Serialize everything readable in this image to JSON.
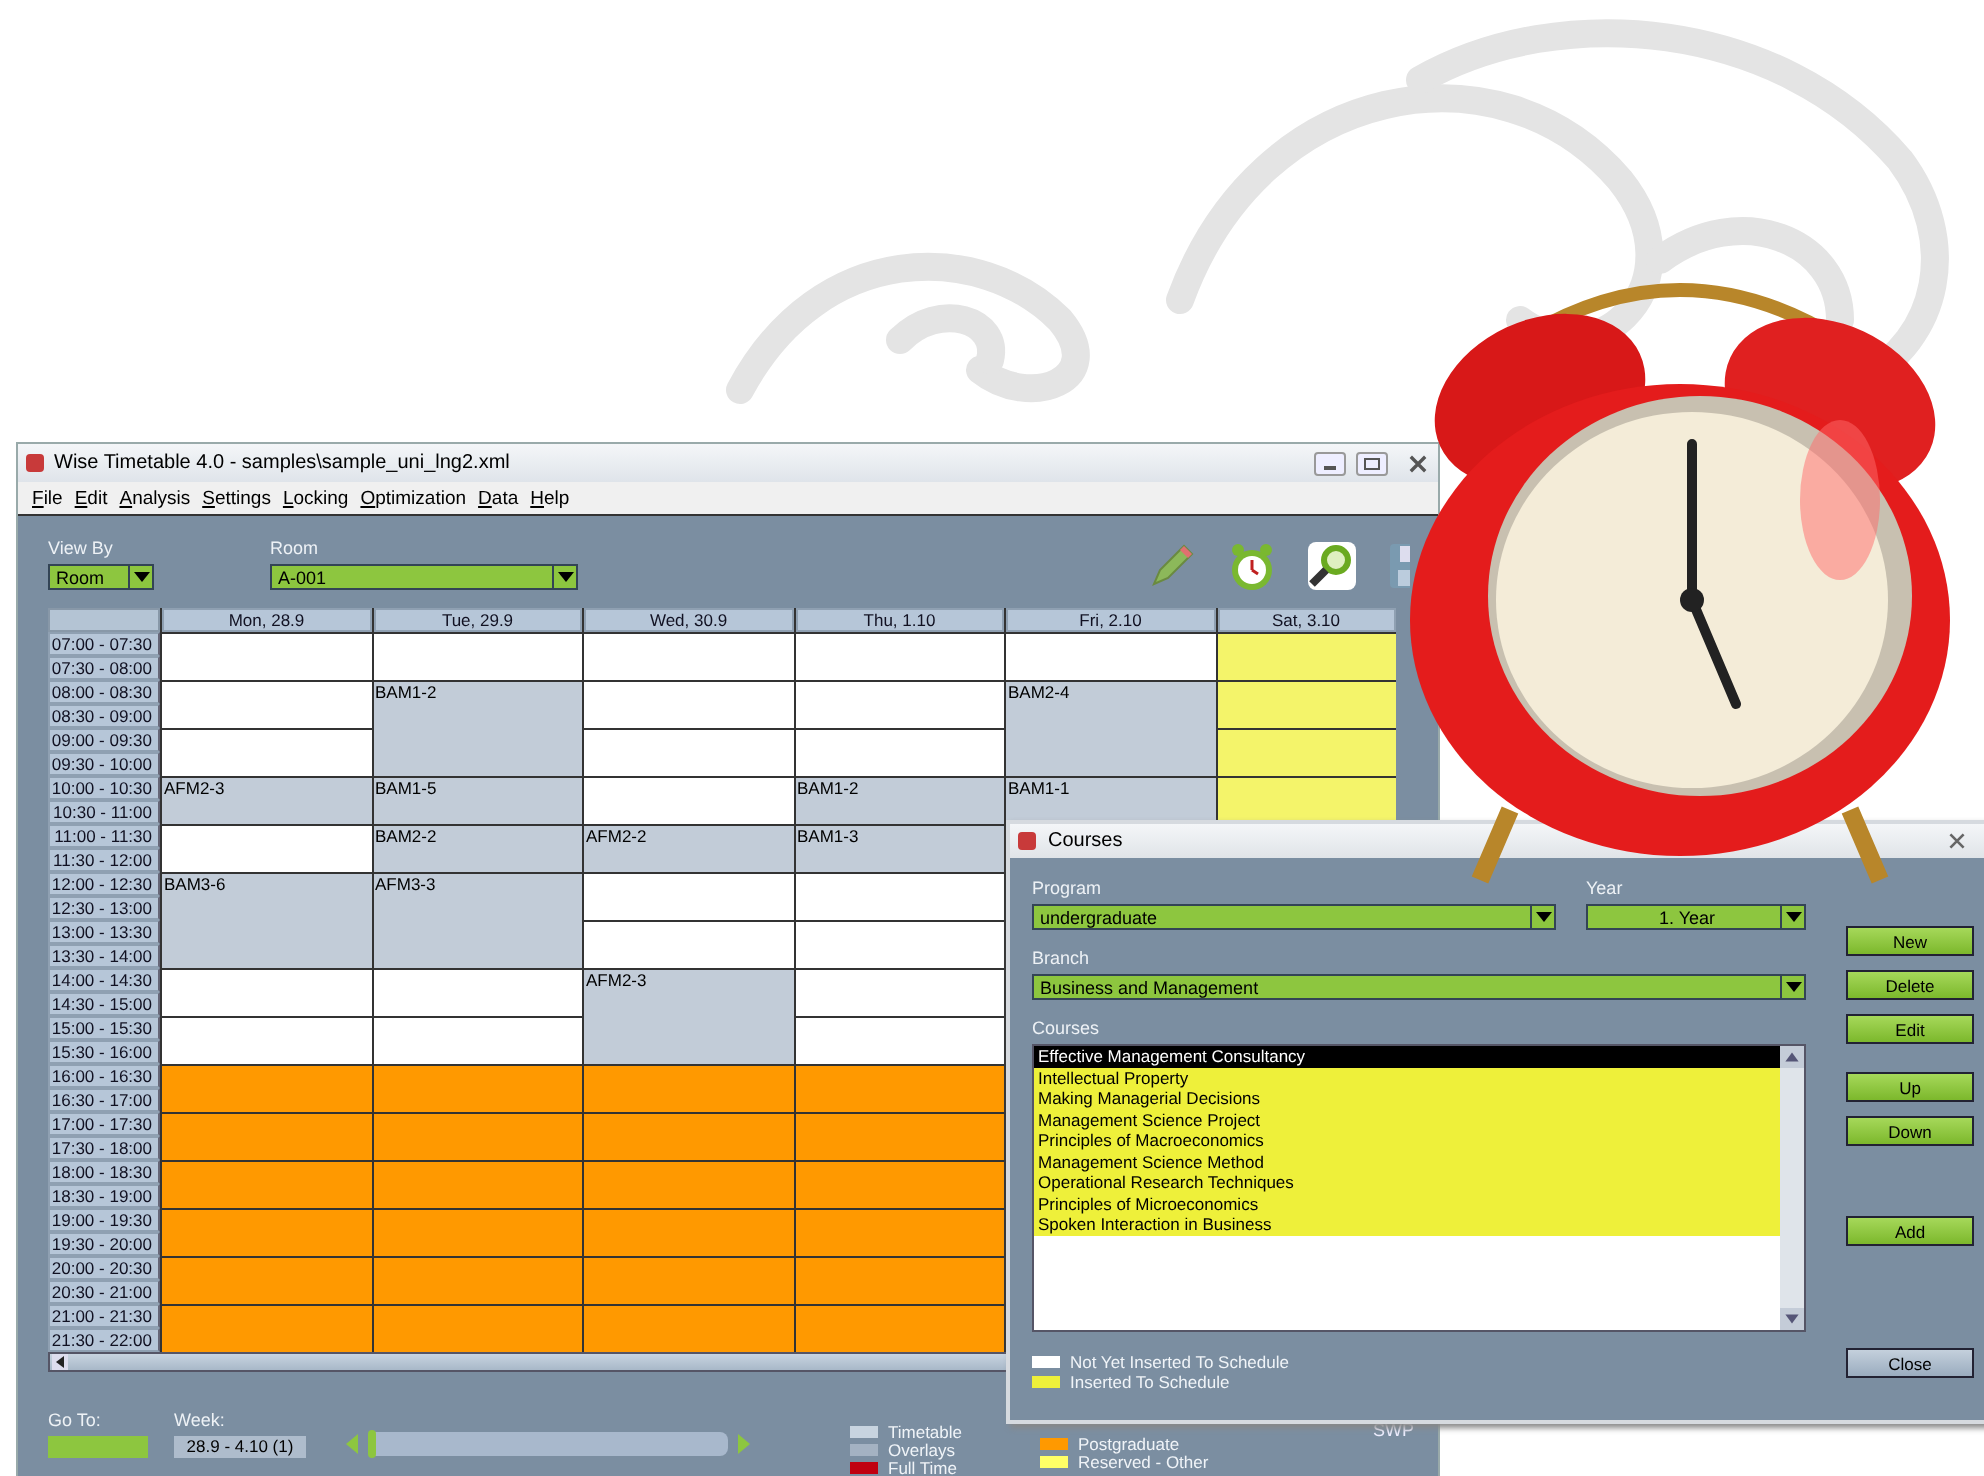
{
  "window": {
    "title": "Wise Timetable 4.0 - samples\\sample_uni_lng2.xml"
  },
  "menu": [
    "File",
    "Edit",
    "Analysis",
    "Settings",
    "Locking",
    "Optimization",
    "Data",
    "Help"
  ],
  "view_by": {
    "label": "View By",
    "value": "Room"
  },
  "room": {
    "label": "Room",
    "value": "A-001"
  },
  "times": [
    "07:00 - 07:30",
    "07:30 - 08:00",
    "08:00 - 08:30",
    "08:30 - 09:00",
    "09:00 - 09:30",
    "09:30 - 10:00",
    "10:00 - 10:30",
    "10:30 - 11:00",
    "11:00 - 11:30",
    "11:30 - 12:00",
    "12:00 - 12:30",
    "12:30 - 13:00",
    "13:00 - 13:30",
    "13:30 - 14:00",
    "14:00 - 14:30",
    "14:30 - 15:00",
    "15:00 - 15:30",
    "15:30 - 16:00",
    "16:00 - 16:30",
    "16:30 - 17:00",
    "17:00 - 17:30",
    "17:30 - 18:00",
    "18:00 - 18:30",
    "18:30 - 19:00",
    "19:00 - 19:30",
    "19:30 - 20:00",
    "20:00 - 20:30",
    "20:30 - 21:00",
    "21:00 - 21:30",
    "21:30 - 22:00"
  ],
  "days": [
    {
      "label": "Mon, 28.9",
      "cells": [
        {
          "kind": "free"
        },
        {
          "kind": "free"
        },
        {
          "kind": "free"
        },
        {
          "kind": "class",
          "label": "AFM2-3"
        },
        {
          "kind": "free"
        },
        {
          "kind": "class",
          "label": "BAM3-6"
        },
        {
          "kind": "class",
          "joined": true
        },
        {
          "kind": "free"
        },
        {
          "kind": "free"
        },
        {
          "kind": "evening"
        },
        {
          "kind": "evening"
        },
        {
          "kind": "evening"
        },
        {
          "kind": "evening"
        },
        {
          "kind": "evening"
        },
        {
          "kind": "evening"
        }
      ]
    },
    {
      "label": "Tue, 29.9",
      "cells": [
        {
          "kind": "free"
        },
        {
          "kind": "class",
          "label": "BAM1-2"
        },
        {
          "kind": "class",
          "joined": true
        },
        {
          "kind": "class",
          "label": "BAM1-5"
        },
        {
          "kind": "class",
          "label": "BAM2-2"
        },
        {
          "kind": "class",
          "label": "AFM3-3"
        },
        {
          "kind": "class",
          "joined": true
        },
        {
          "kind": "free"
        },
        {
          "kind": "free"
        },
        {
          "kind": "evening"
        },
        {
          "kind": "evening"
        },
        {
          "kind": "evening"
        },
        {
          "kind": "evening"
        },
        {
          "kind": "evening"
        },
        {
          "kind": "evening"
        }
      ]
    },
    {
      "label": "Wed, 30.9",
      "cells": [
        {
          "kind": "free"
        },
        {
          "kind": "free"
        },
        {
          "kind": "free"
        },
        {
          "kind": "free"
        },
        {
          "kind": "class",
          "label": "AFM2-2"
        },
        {
          "kind": "free"
        },
        {
          "kind": "free"
        },
        {
          "kind": "class",
          "label": "AFM2-3"
        },
        {
          "kind": "class",
          "joined": true
        },
        {
          "kind": "evening"
        },
        {
          "kind": "evening"
        },
        {
          "kind": "evening"
        },
        {
          "kind": "evening"
        },
        {
          "kind": "evening"
        },
        {
          "kind": "evening"
        }
      ]
    },
    {
      "label": "Thu, 1.10",
      "cells": [
        {
          "kind": "free"
        },
        {
          "kind": "free"
        },
        {
          "kind": "free"
        },
        {
          "kind": "class",
          "label": "BAM1-2"
        },
        {
          "kind": "class",
          "label": "BAM1-3"
        },
        {
          "kind": "free"
        },
        {
          "kind": "free"
        },
        {
          "kind": "free"
        },
        {
          "kind": "free"
        },
        {
          "kind": "evening"
        },
        {
          "kind": "evening"
        },
        {
          "kind": "evening"
        },
        {
          "kind": "evening"
        },
        {
          "kind": "evening"
        },
        {
          "kind": "evening"
        }
      ]
    },
    {
      "label": "Fri, 2.10",
      "cells": [
        {
          "kind": "free"
        },
        {
          "kind": "class",
          "label": "BAM2-4"
        },
        {
          "kind": "class",
          "joined": true
        },
        {
          "kind": "class",
          "label": "BAM1-1"
        }
      ]
    },
    {
      "label": "Sat, 3.10",
      "cells": [
        {
          "kind": "reserved"
        },
        {
          "kind": "reserved"
        },
        {
          "kind": "reserved"
        },
        {
          "kind": "reserved"
        }
      ]
    }
  ],
  "go_to": {
    "label": "Go To:"
  },
  "week": {
    "label": "Week:",
    "value": "28.9 - 4.10 (1)",
    "level": 0
  },
  "legend": [
    {
      "label": "Timetable",
      "color": "#c8d4e0"
    },
    {
      "label": "Overlays",
      "color": "#a4b2c2"
    },
    {
      "label": "Full Time",
      "color": "#c00010"
    }
  ],
  "legend_2": [
    {
      "label": "Postgraduate",
      "color": "#ff9900"
    },
    {
      "label": "Reserved - Other",
      "color": "#ffff66"
    }
  ],
  "status_code": "SWP",
  "dialog": {
    "title": "Courses",
    "program": {
      "label": "Program",
      "value": "undergraduate"
    },
    "year": {
      "label": "Year",
      "value": "1. Year"
    },
    "branch": {
      "label": "Branch",
      "value": "Business and Management"
    },
    "courses_label": "Courses",
    "courses": [
      {
        "name": "Effective Management Consultancy",
        "selected": true,
        "inserted": true
      },
      {
        "name": "Intellectual Property",
        "selected": false,
        "inserted": true
      },
      {
        "name": "Making Managerial Decisions",
        "selected": false,
        "inserted": true
      },
      {
        "name": "Management Science Project",
        "selected": false,
        "inserted": true
      },
      {
        "name": "Principles of Macroeconomics",
        "selected": false,
        "inserted": true
      },
      {
        "name": "Management Science Method",
        "selected": false,
        "inserted": true
      },
      {
        "name": "Operational Research Techniques",
        "selected": false,
        "inserted": true
      },
      {
        "name": "Principles of Microeconomics",
        "selected": false,
        "inserted": true
      },
      {
        "name": "Spoken Interaction in Business",
        "selected": false,
        "inserted": true
      }
    ],
    "buttons": [
      {
        "label": "New",
        "kind": "green"
      },
      {
        "label": "Delete",
        "kind": "green"
      },
      {
        "label": "Edit",
        "kind": "green"
      },
      {
        "label": "Up",
        "kind": "green"
      },
      {
        "label": "Down",
        "kind": "green"
      },
      {
        "label": "Add",
        "kind": "green"
      },
      {
        "label": "Close",
        "kind": "plain"
      }
    ],
    "legend": [
      {
        "label": "Not Yet Inserted To Schedule",
        "color": "#ffffff"
      },
      {
        "label": "Inserted To Schedule",
        "color": "#eef03a"
      }
    ]
  }
}
